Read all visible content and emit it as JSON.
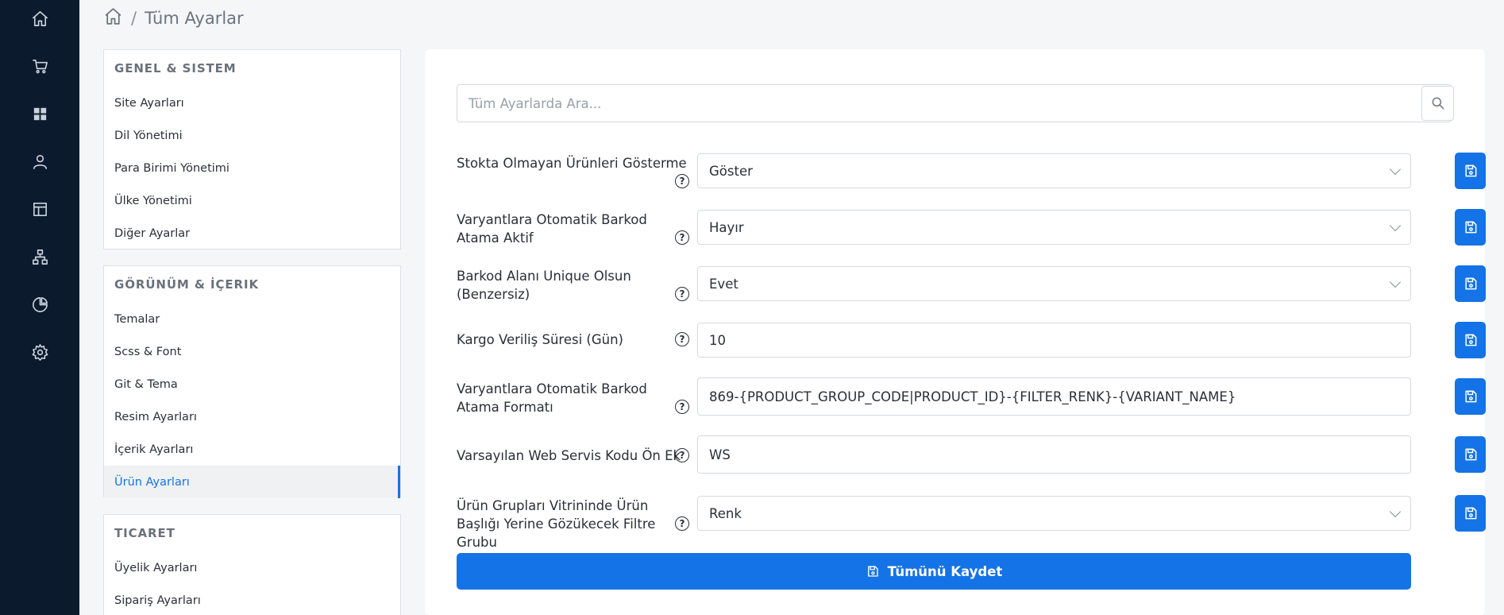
{
  "breadcrumb": {
    "home_icon": "home-icon",
    "separator": "/",
    "current": "Tüm Ayarlar"
  },
  "rail": {
    "icons": [
      "home-icon",
      "cart-icon",
      "grid-icon",
      "user-icon",
      "layout-icon",
      "sitemap-icon",
      "pie-chart-icon",
      "gear-icon"
    ]
  },
  "menu": {
    "general": {
      "title": "GENEL & SISTEM",
      "items": [
        "Site Ayarları",
        "Dil Yönetimi",
        "Para Birimi Yönetimi",
        "Ülke Yönetimi",
        "Diğer Ayarlar"
      ]
    },
    "appearance": {
      "title": "GÖRÜNÜM & İÇERIK",
      "items": [
        "Temalar",
        "Scss & Font",
        "Git & Tema",
        "Resim Ayarları",
        "İçerik Ayarları",
        "Ürün Ayarları"
      ],
      "active": "Ürün Ayarları"
    },
    "commerce": {
      "title": "TICARET",
      "items": [
        "Üyelik Ayarları",
        "Sipariş Ayarları"
      ]
    }
  },
  "search": {
    "placeholder": "Tüm Ayarlarda Ara..."
  },
  "settings": [
    {
      "label": "Stokta Olmayan Ürünleri Gösterme",
      "type": "select",
      "value": "Göster"
    },
    {
      "label": "Varyantlara Otomatik Barkod Atama Aktif",
      "type": "select",
      "value": "Hayır"
    },
    {
      "label": "Barkod Alanı Unique Olsun (Benzersiz)",
      "type": "select",
      "value": "Evet"
    },
    {
      "label": "Kargo Veriliş Süresi (Gün)",
      "type": "input",
      "value": "10"
    },
    {
      "label": "Varyantlara Otomatik Barkod Atama Formatı",
      "type": "input",
      "value": "869-{PRODUCT_GROUP_CODE|PRODUCT_ID}-{FILTER_RENK}-{VARIANT_NAME}"
    },
    {
      "label": "Varsayılan Web Servis Kodu Ön Ek",
      "type": "input",
      "value": "WS"
    },
    {
      "label": "Ürün Grupları Vitrininde Ürün Başlığı Yerine Gözükecek Filtre Grubu",
      "type": "select",
      "value": "Renk"
    }
  ],
  "help_glyph": "?",
  "save_all_label": "Tümünü Kaydet",
  "colors": {
    "rail_bg": "#0b1a2c",
    "accent": "#1473e6",
    "page_bg": "#f5f6f8"
  }
}
